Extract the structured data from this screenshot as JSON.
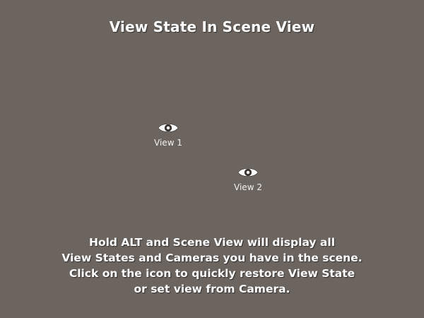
{
  "scene": {
    "title": "View State In Scene View",
    "background_color": "#6b645f"
  },
  "view_markers": [
    {
      "label": "View 1",
      "icon": "eye-icon"
    },
    {
      "label": "View 2",
      "icon": "eye-icon"
    }
  ],
  "instructions": {
    "lines": [
      "Hold ALT and Scene View will display all",
      "View States and Cameras you have in the scene.",
      "Click on the icon to quickly restore View State",
      "or set view from Camera."
    ]
  }
}
